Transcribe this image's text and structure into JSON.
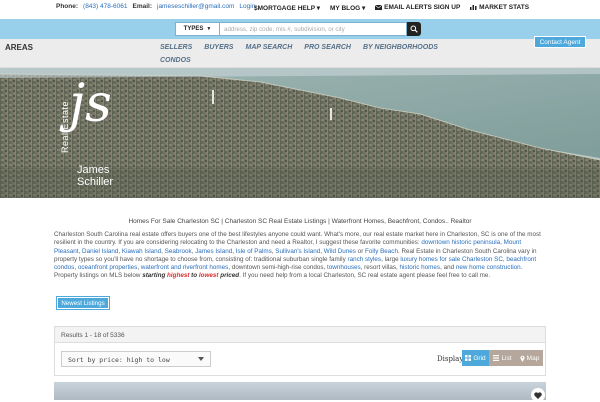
{
  "topbar": {
    "phone_label": "Phone:",
    "phone": "(843) 478-6061",
    "email_label": "Email:",
    "email": "jameseschiller@gmail.com",
    "login": "Login",
    "nav": [
      {
        "label": "$MORTGAGE HELP",
        "caret": "▾"
      },
      {
        "label": "MY BLOG",
        "caret": "▾"
      },
      {
        "label": "EMAIL ALERTS SIGN UP"
      },
      {
        "label": "MARKET STATS"
      }
    ]
  },
  "search": {
    "types_label": "TYPES",
    "placeholder": "address, zip code, mls #, subdivision, or city"
  },
  "subnav": {
    "areas": "AREAS",
    "row1": [
      "SELLERS",
      "BUYERS",
      "MAP SEARCH",
      "PRO SEARCH",
      "BY NEIGHBORHOODS"
    ],
    "row2": [
      "CONDOS"
    ],
    "contact_agent": "Contact Agent"
  },
  "logo": {
    "vertical": "Real Estate",
    "monogram": "js",
    "first_name": "James",
    "last_name": "Schiller"
  },
  "content": {
    "headline": "Homes For Sale Charleston SC | Charleston SC Real Estate Listings | Waterfront Homes, Beachfront, Condos.. Realtor",
    "p1": "Charleston South Carolina real estate offers buyers one of the best lifestyles anyone could want. What's more, our real estate market here in Charleston, SC is one of the most resilient in the country. If you are considering relocating to the Charleston and need a Realtor, I suggest these favorite communities: ",
    "l1": "downtown historic peninsula",
    "s1": ", ",
    "l2": "Mount Pleasant",
    "s2": ", ",
    "l3": "Daniel Island",
    "s3": ", ",
    "l4": "Kiawah Island",
    "s4": ", ",
    "l5": "Seabrook",
    "s5": ", ",
    "l6": "James Island",
    "s6": ", ",
    "l7": "Isle of Palms",
    "s7": ", ",
    "l8": "Sullivan's Island",
    "s8": ", ",
    "l9": "Wild Dunes",
    "s9": " or ",
    "l10": "Folly Beach",
    "p2": ". Real Estate in Charleston South Carolina vary in property types so you'll have no shortage to choose from, consisting of: traditional suburban single family ",
    "l11": "ranch styles",
    "p3": ", large ",
    "l12": "luxury homes for sale Charleston SC",
    "s12": ", ",
    "l13": "beachfront condos",
    "s13": ", ",
    "l14": "oceanfront properties",
    "s14": ", ",
    "l15": "waterfront and riverfront homes",
    "p4": ", downtown semi-high-rise condos, ",
    "l16": "townhouses",
    "p5": ", resort villas, ",
    "l17": "historic homes",
    "p6": ", and ",
    "l18": "new home construction",
    "p7": ". Property listings on MLS below ",
    "em1": "starting ",
    "red1": "highest",
    "em2": " to ",
    "red2": "lowest",
    "em3": " priced",
    "p8": ". If you need help from a local Charleston, SC real estate agent please feel free to call me.",
    "newest_button": "Newest Listings"
  },
  "results": {
    "summary": "Results 1 - 18 of 5336",
    "sort_value": "Sort by price: high to low",
    "display_label": "Display",
    "views": {
      "grid": "Grid",
      "list": "List",
      "map": "Map"
    }
  },
  "colors": {
    "accent": "#4da9db",
    "bluebar": "#98d0ec",
    "link": "#2a6ebb",
    "highlight_red": "#d9302c"
  }
}
